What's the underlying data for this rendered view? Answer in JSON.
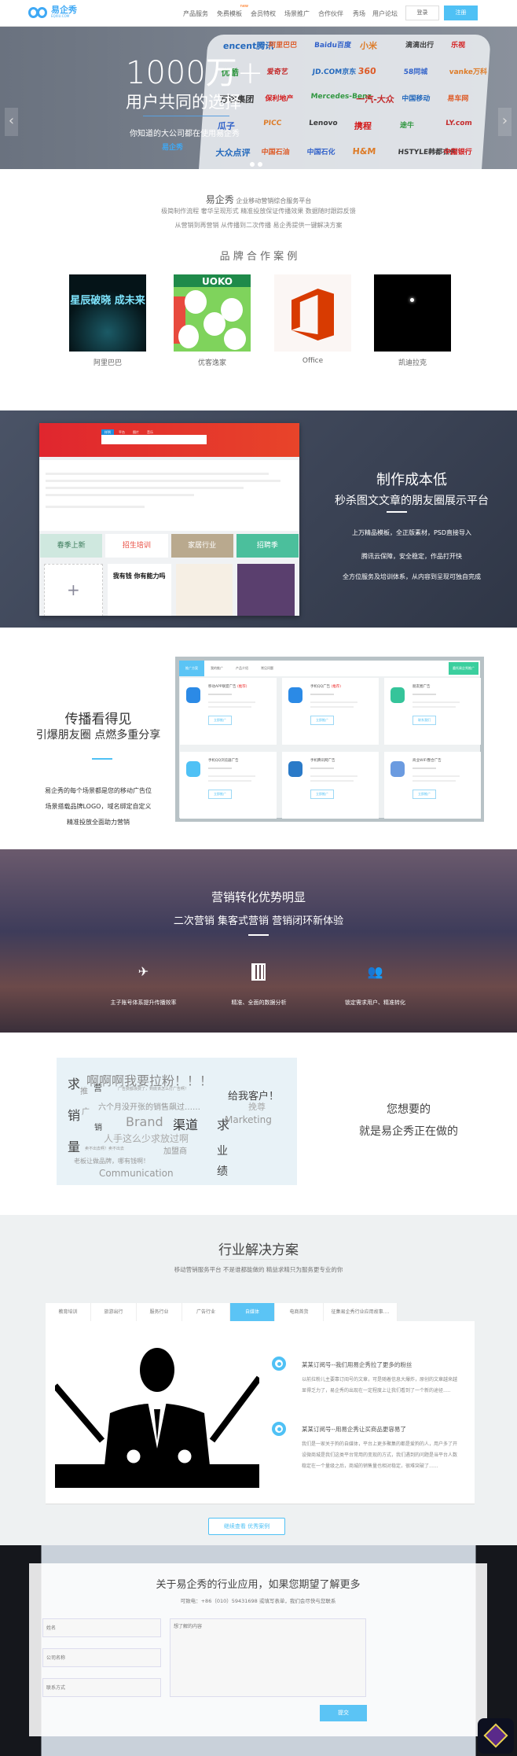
{
  "header": {
    "logo": "易企秀",
    "logo_sub": "EQXIU.COM",
    "nav": [
      "产品服务",
      "免费模板",
      "会员特权",
      "场景推广",
      "合作伙伴",
      "秀场",
      "用户论坛"
    ],
    "new_badge": "new",
    "login": "登录",
    "register": "注册"
  },
  "hero": {
    "big": "1000万+",
    "sub": "用户共同的选择",
    "text": "你知道的大公司都在使用易企秀",
    "logo": "易企秀",
    "brands": [
      "encent腾讯",
      "阿里巴巴",
      "Baidu百度",
      "小米",
      "滴滴出行",
      "乐视",
      "优酷",
      "爱奇艺",
      "JD.COM京东",
      "360",
      "58同城",
      "vanke万科",
      "万达集团",
      "保利地产",
      "Mercedes-Benz",
      "一汽-大众",
      "中国移动",
      "易车网",
      "瓜子",
      "PICC",
      "Lenovo",
      "携程",
      "途牛",
      "LY.com",
      "大众点评",
      "中国石油",
      "中国石化",
      "H&M",
      "HSTYLE韩都衣舍",
      "中国银行",
      "中国工商银行",
      "七匹狼"
    ]
  },
  "intro": {
    "brand": "易企秀",
    "tagline": "企业移动营销综合服务平台",
    "line1": "极简制作流程 奢华呈现形式 精准投放保证传播效果 数据随时跟踪反馈",
    "line2": "从营销到再营销 从传播到二次传播 易企秀提供一键解决方案",
    "cases_title": "品 牌 合 作 案 例",
    "cases": [
      {
        "label": "阿里巴巴",
        "art": "星辰破晓 成未来"
      },
      {
        "label": "优客逸家",
        "art": "UOKO"
      },
      {
        "label": "Office",
        "art": ""
      },
      {
        "label": "凯迪拉克",
        "art": ""
      }
    ]
  },
  "cost": {
    "title": "制作成本低",
    "subtitle": "秒杀图文文章的朋友圈展示平台",
    "bullets": [
      "上万精品模板，全正版素材，PSD直接导入",
      "腾讯云保障，安全稳定，作品打开快",
      "全方位服务及培训体系，从内容到呈现可独自完成"
    ],
    "shot_tabs": [
      "样例",
      "平台",
      "图片",
      "音乐"
    ],
    "banners": [
      "春季上新",
      "招生培训",
      "家居行业",
      "招聘季"
    ],
    "poster": "我有钱 你有能力吗"
  },
  "spread": {
    "title": "传播看得见",
    "subtitle": "引爆朋友圈  点燃多重分享",
    "lines": [
      "易企秀的每个场景都是您的移动广告位",
      "场景搭载品牌LOGO，域名绑定自定义",
      "精准投放全面助力营销"
    ],
    "panel_tabs": [
      "推广方案",
      "我的推广",
      "产品介绍",
      "常见问题"
    ],
    "panel_btn": "委托易企秀推广",
    "cards": [
      {
        "name": "移动APP联盟广告",
        "tag": "(推荐)",
        "btn": "立即推广",
        "color": "#2b8ae6"
      },
      {
        "name": "手机QQ广告",
        "tag": "(推荐)",
        "btn": "立即推广",
        "color": "#2b8ae6"
      },
      {
        "name": "朋友圈广告",
        "tag": "",
        "btn": "联系我们",
        "color": "#35c49a"
      },
      {
        "name": "手机QQ浏览器广告",
        "tag": "",
        "btn": "立即推广",
        "color": "#4fc1f5"
      },
      {
        "name": "手机腾讯网广告",
        "tag": "",
        "btn": "立即推广",
        "color": "#2a7ac8"
      },
      {
        "name": "商业WIFI整合广告",
        "tag": "",
        "btn": "立即推广",
        "color": "#6b9be0"
      }
    ]
  },
  "mkt": {
    "title": "营销转化优势明显",
    "subtitle": "二次营销  集客式营销  营销闭环新体验",
    "features": [
      {
        "icon": "plane-icon",
        "label": "主子账号体系提升传播效率"
      },
      {
        "icon": "calculator-icon",
        "label": "精准、全面的数据分析"
      },
      {
        "icon": "users-icon",
        "label": "锁定需求用户、精准转化"
      }
    ]
  },
  "words": {
    "cloud": [
      "求",
      "啊啊啊我要拉粉！！！",
      "推",
      "营",
      "广告费都浪费了，到底该怎么打广告啊！",
      "给我客户！",
      "销",
      "广",
      "六个月没开张的销售飙过……",
      "挽尊",
      "销",
      "Brand",
      "渠道",
      "求",
      "Marketing",
      "量",
      "人手这么少求放过啊",
      "卖不出去啊！卖不出去",
      "加盟商",
      "业",
      "老板让做品牌，哪有钱啊！",
      "Communication",
      "绩"
    ],
    "line1": "您想要的",
    "line2": "就是易企秀正在做的"
  },
  "industry": {
    "title": "行业解决方案",
    "subtitle": "移动营销服务平台 不是谁都能做的  精益求精只为服务更专业的你",
    "tabs": [
      "教育培训",
      "旅游出行",
      "服务行业",
      "广告行业",
      "自媒体",
      "电商首货",
      "征集易企秀行业应用故事...."
    ],
    "active_tab": 4,
    "stories": [
      {
        "title": "某某订阅号--我们用易企秀拉了更多的粉丝",
        "text": "以前拉粉儿主要靠订阅号的文章，可是随着信息大爆炸，原创的文章越来越显得乏力了，易企秀的出现在一定程度上让我们看到了一个新的途径....."
      },
      {
        "title": "某某订阅号--用易企秀让买商品更容易了",
        "text": "我们是一家关于狗的自媒体，平台上更多聚集的都是爱狗的人，用户多了开设微商城是我们这类平台常用的变现的方式，我们遇到的问题是当平台人数稳定在一个量级之后，商城的销售量也相对稳定，很难突破了......"
      }
    ],
    "more": "继续查看  优秀案例"
  },
  "contact": {
    "title": "关于易企秀的行业应用，如果您期望了解更多",
    "phone": "可致电：+86（010）59431698  或填写表单，我们会尽快与您联系",
    "name_ph": "姓名",
    "company_ph": "公司名称",
    "contact_ph": "联系方式",
    "content_ph": "想了解的内容",
    "submit": "提交"
  },
  "colors": {
    "accent": "#4fc1f5",
    "green": "#35c49a",
    "dark": "#3a4254"
  }
}
